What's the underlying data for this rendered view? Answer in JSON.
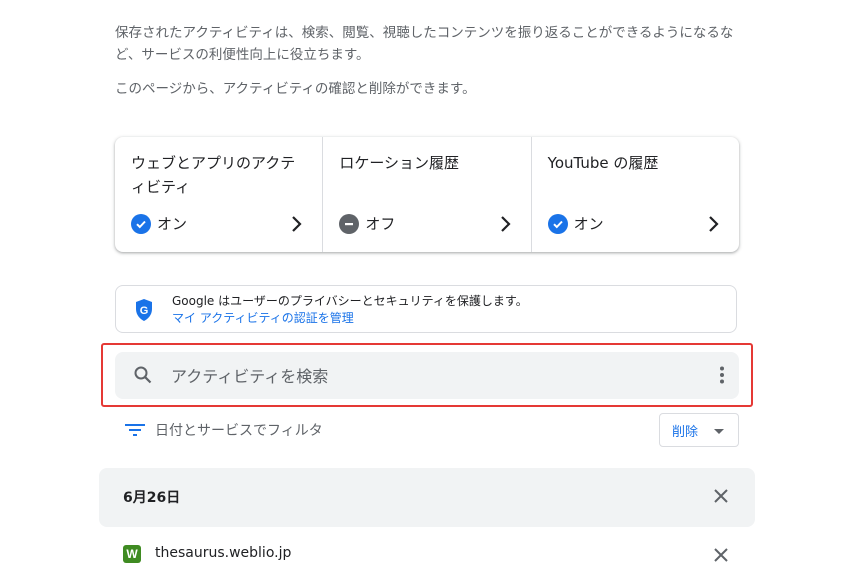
{
  "intro": {
    "paragraph1": "保存されたアクティビティは、検索、閲覧、視聴したコンテンツを振り返ることができるようになるなど、サービスの利便性向上に役立ちます。",
    "paragraph2": "このページから、アクティビティの確認と削除ができます。"
  },
  "cards": [
    {
      "title": "ウェブとアプリのアクティビティ",
      "status": "オン",
      "status_icon": "check-circle-icon"
    },
    {
      "title": "ロケーション履歴",
      "status": "オフ",
      "status_icon": "minus-circle-icon"
    },
    {
      "title": "YouTube の履歴",
      "status": "オン",
      "status_icon": "check-circle-icon"
    }
  ],
  "privacy": {
    "text": "Google はユーザーのプライバシーとセキュリティを保護します。",
    "link": "マイ アクティビティの認証を管理",
    "icon": "google-shield-icon"
  },
  "search": {
    "placeholder": "アクティビティを検索",
    "icon": "search-icon",
    "menu_icon": "more-vert-icon"
  },
  "filter": {
    "label": "日付とサービスでフィルタ",
    "icon": "filter-icon"
  },
  "delete_button": {
    "label": "削除"
  },
  "activity": {
    "date": "6月26日",
    "items": [
      {
        "site": "thesaurus.weblio.jp",
        "icon_letter": "W"
      }
    ]
  },
  "colors": {
    "accent": "#1a73e8",
    "highlight": "#e53935",
    "search_bg": "#f1f3f4"
  }
}
